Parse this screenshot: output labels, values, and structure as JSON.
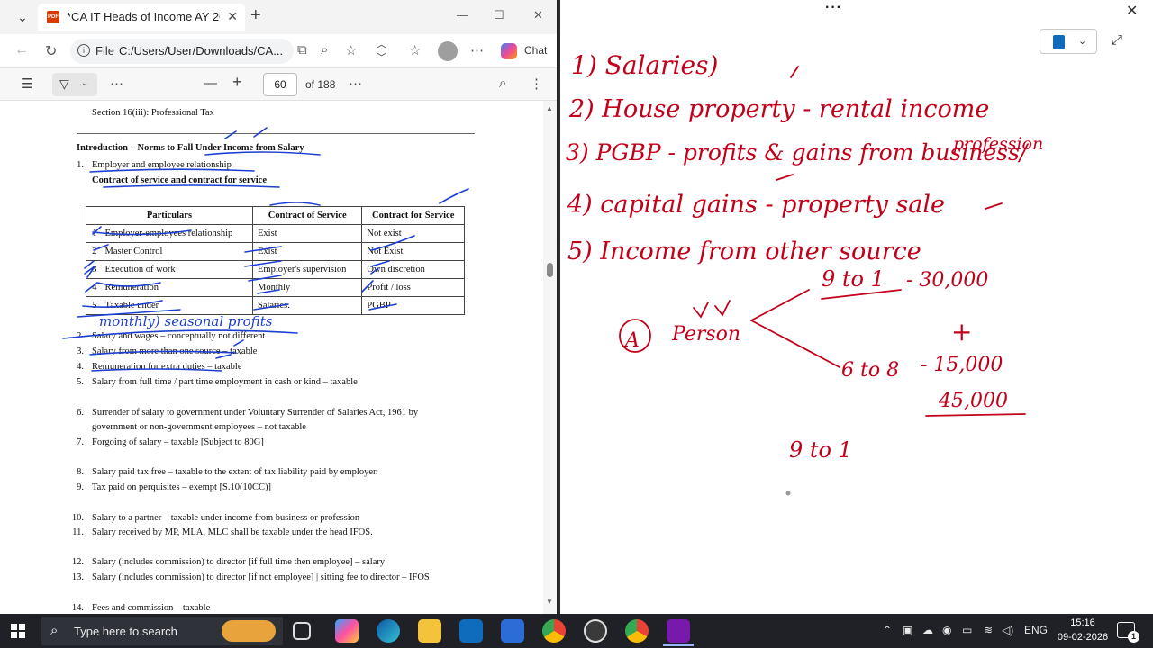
{
  "browser": {
    "tab_title": "*CA IT Heads of Income AY 2025-2",
    "pdf_icon_label": "PDF",
    "url_prefix": "File",
    "url": "C:/Users/User/Downloads/CA...",
    "chat_label": "Chat",
    "page_current": "60",
    "page_of": "of 188"
  },
  "doc": {
    "section_line": "Section 16(iii): Professional Tax",
    "intro_heading": "Introduction – Norms to Fall Under Income from Salary",
    "item1_num": "1.",
    "item1": "Employer and employee relationship",
    "item1_sub": "Contract of service and contract for service",
    "table": {
      "headers": [
        "Particulars",
        "Contract of Service",
        "Contract for Service"
      ],
      "rows": [
        {
          "n": "1",
          "particular": "Employer-employees relationship",
          "cos": "Exist",
          "cfs": "Not exist"
        },
        {
          "n": "2",
          "particular": "Master Control",
          "cos": "Exist",
          "cfs": "Not Exist"
        },
        {
          "n": "3",
          "particular": "Execution of work",
          "cos": "Employer's supervision",
          "cfs": "Own discretion"
        },
        {
          "n": "4",
          "particular": "Remuneration",
          "cos": "Monthly",
          "cfs": "Profit / loss"
        },
        {
          "n": "5",
          "particular": "Taxable under",
          "cos": "Salaries.",
          "cfs": "PGBP"
        }
      ]
    },
    "items": [
      {
        "num": "2.",
        "text": "Salary and wages – conceptually not different"
      },
      {
        "num": "3.",
        "text": "Salary from more than one source – taxable"
      },
      {
        "num": "4.",
        "text": "Remuneration for extra duties – taxable"
      },
      {
        "num": "5.",
        "text": "Salary from full time / part time employment in cash or kind – taxable"
      },
      {
        "num": "6.",
        "text": "Surrender of salary to government under Voluntary Surrender of Salaries Act, 1961 by"
      },
      {
        "num": "",
        "text": "government or non-government employees – not taxable"
      },
      {
        "num": "7.",
        "text": "Forgoing of salary – taxable [Subject to 80G]"
      },
      {
        "num": "8.",
        "text": "Salary paid tax free – taxable to the extent of tax liability paid by employer."
      },
      {
        "num": "9.",
        "text": "Tax paid on perquisites – exempt [S.10(10CC)]"
      },
      {
        "num": "10.",
        "text": "Salary to a partner – taxable under income from business or profession"
      },
      {
        "num": "11.",
        "text": "Salary received by MP, MLA, MLC shall be taxable under the head IFOS."
      },
      {
        "num": "12.",
        "text": "Salary (includes commission) to director [if full time then employee] – salary"
      },
      {
        "num": "13.",
        "text": "Salary (includes commission) to director [if not employee] | sitting fee to director – IFOS"
      },
      {
        "num": "14.",
        "text": "Fees and commission – taxable"
      }
    ],
    "ink_annotation": "monthly)  seasonal profits"
  },
  "onenote": {
    "ink_lines": [
      "1) Salaries)",
      "2) House property - rental income",
      "3) PGBP - profits & gains from business/",
      "profession",
      "4) capital gains - property sale",
      "5) Income from other source"
    ],
    "ink_person": "Person",
    "ink_A": "A",
    "ink_9to1": "9 to 1",
    "ink_30000": "- 30,000",
    "ink_plus": "+",
    "ink_6to8": "6 to 8",
    "ink_15000": "- 15,000",
    "ink_45000": "45,000",
    "ink_9to1_b": "9 to 1"
  },
  "taskbar": {
    "search_placeholder": "Type here to search",
    "lang": "ENG",
    "time": "15:16",
    "date": "09-02-2026",
    "notification_count": "1"
  }
}
